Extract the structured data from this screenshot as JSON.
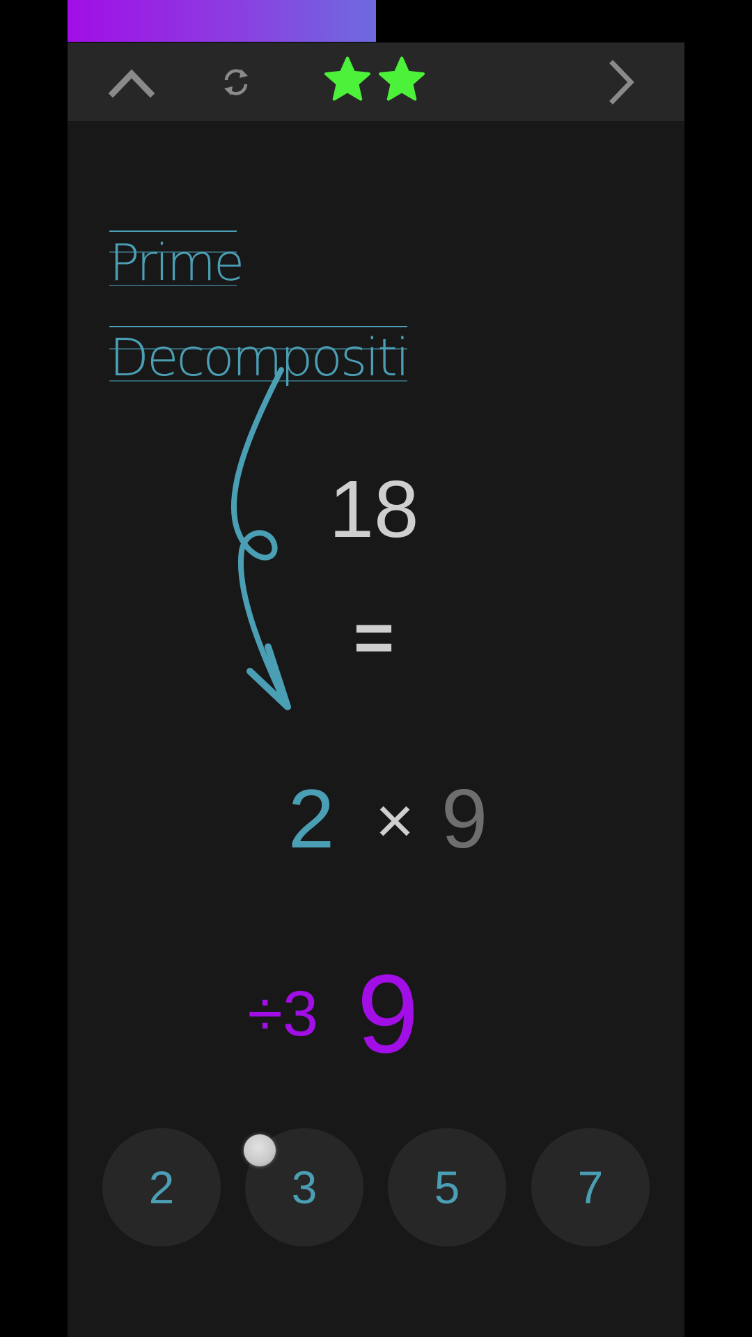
{
  "toolbar": {
    "up_icon": "chevron-up-icon",
    "refresh_icon": "refresh-icon",
    "next_icon": "chevron-right-icon",
    "stars_earned": 2,
    "star_color": "#4cf23a",
    "icon_color": "#8a8a8a"
  },
  "title": {
    "line1": "Prime",
    "line2": "Decompositi"
  },
  "equation": {
    "number": "18",
    "equals": "=",
    "factor_found": "2",
    "times": "×",
    "factor_remaining": "9",
    "hint": "÷3",
    "current_value": "9"
  },
  "prime_buttons": [
    "2",
    "3",
    "5",
    "7"
  ],
  "colors": {
    "background": "#181818",
    "toolbar": "#272727",
    "accent_teal": "#4b9fb5",
    "accent_purple": "#a20ee6",
    "text_light": "#cfcfcf",
    "text_dim": "#6e6e6e"
  }
}
